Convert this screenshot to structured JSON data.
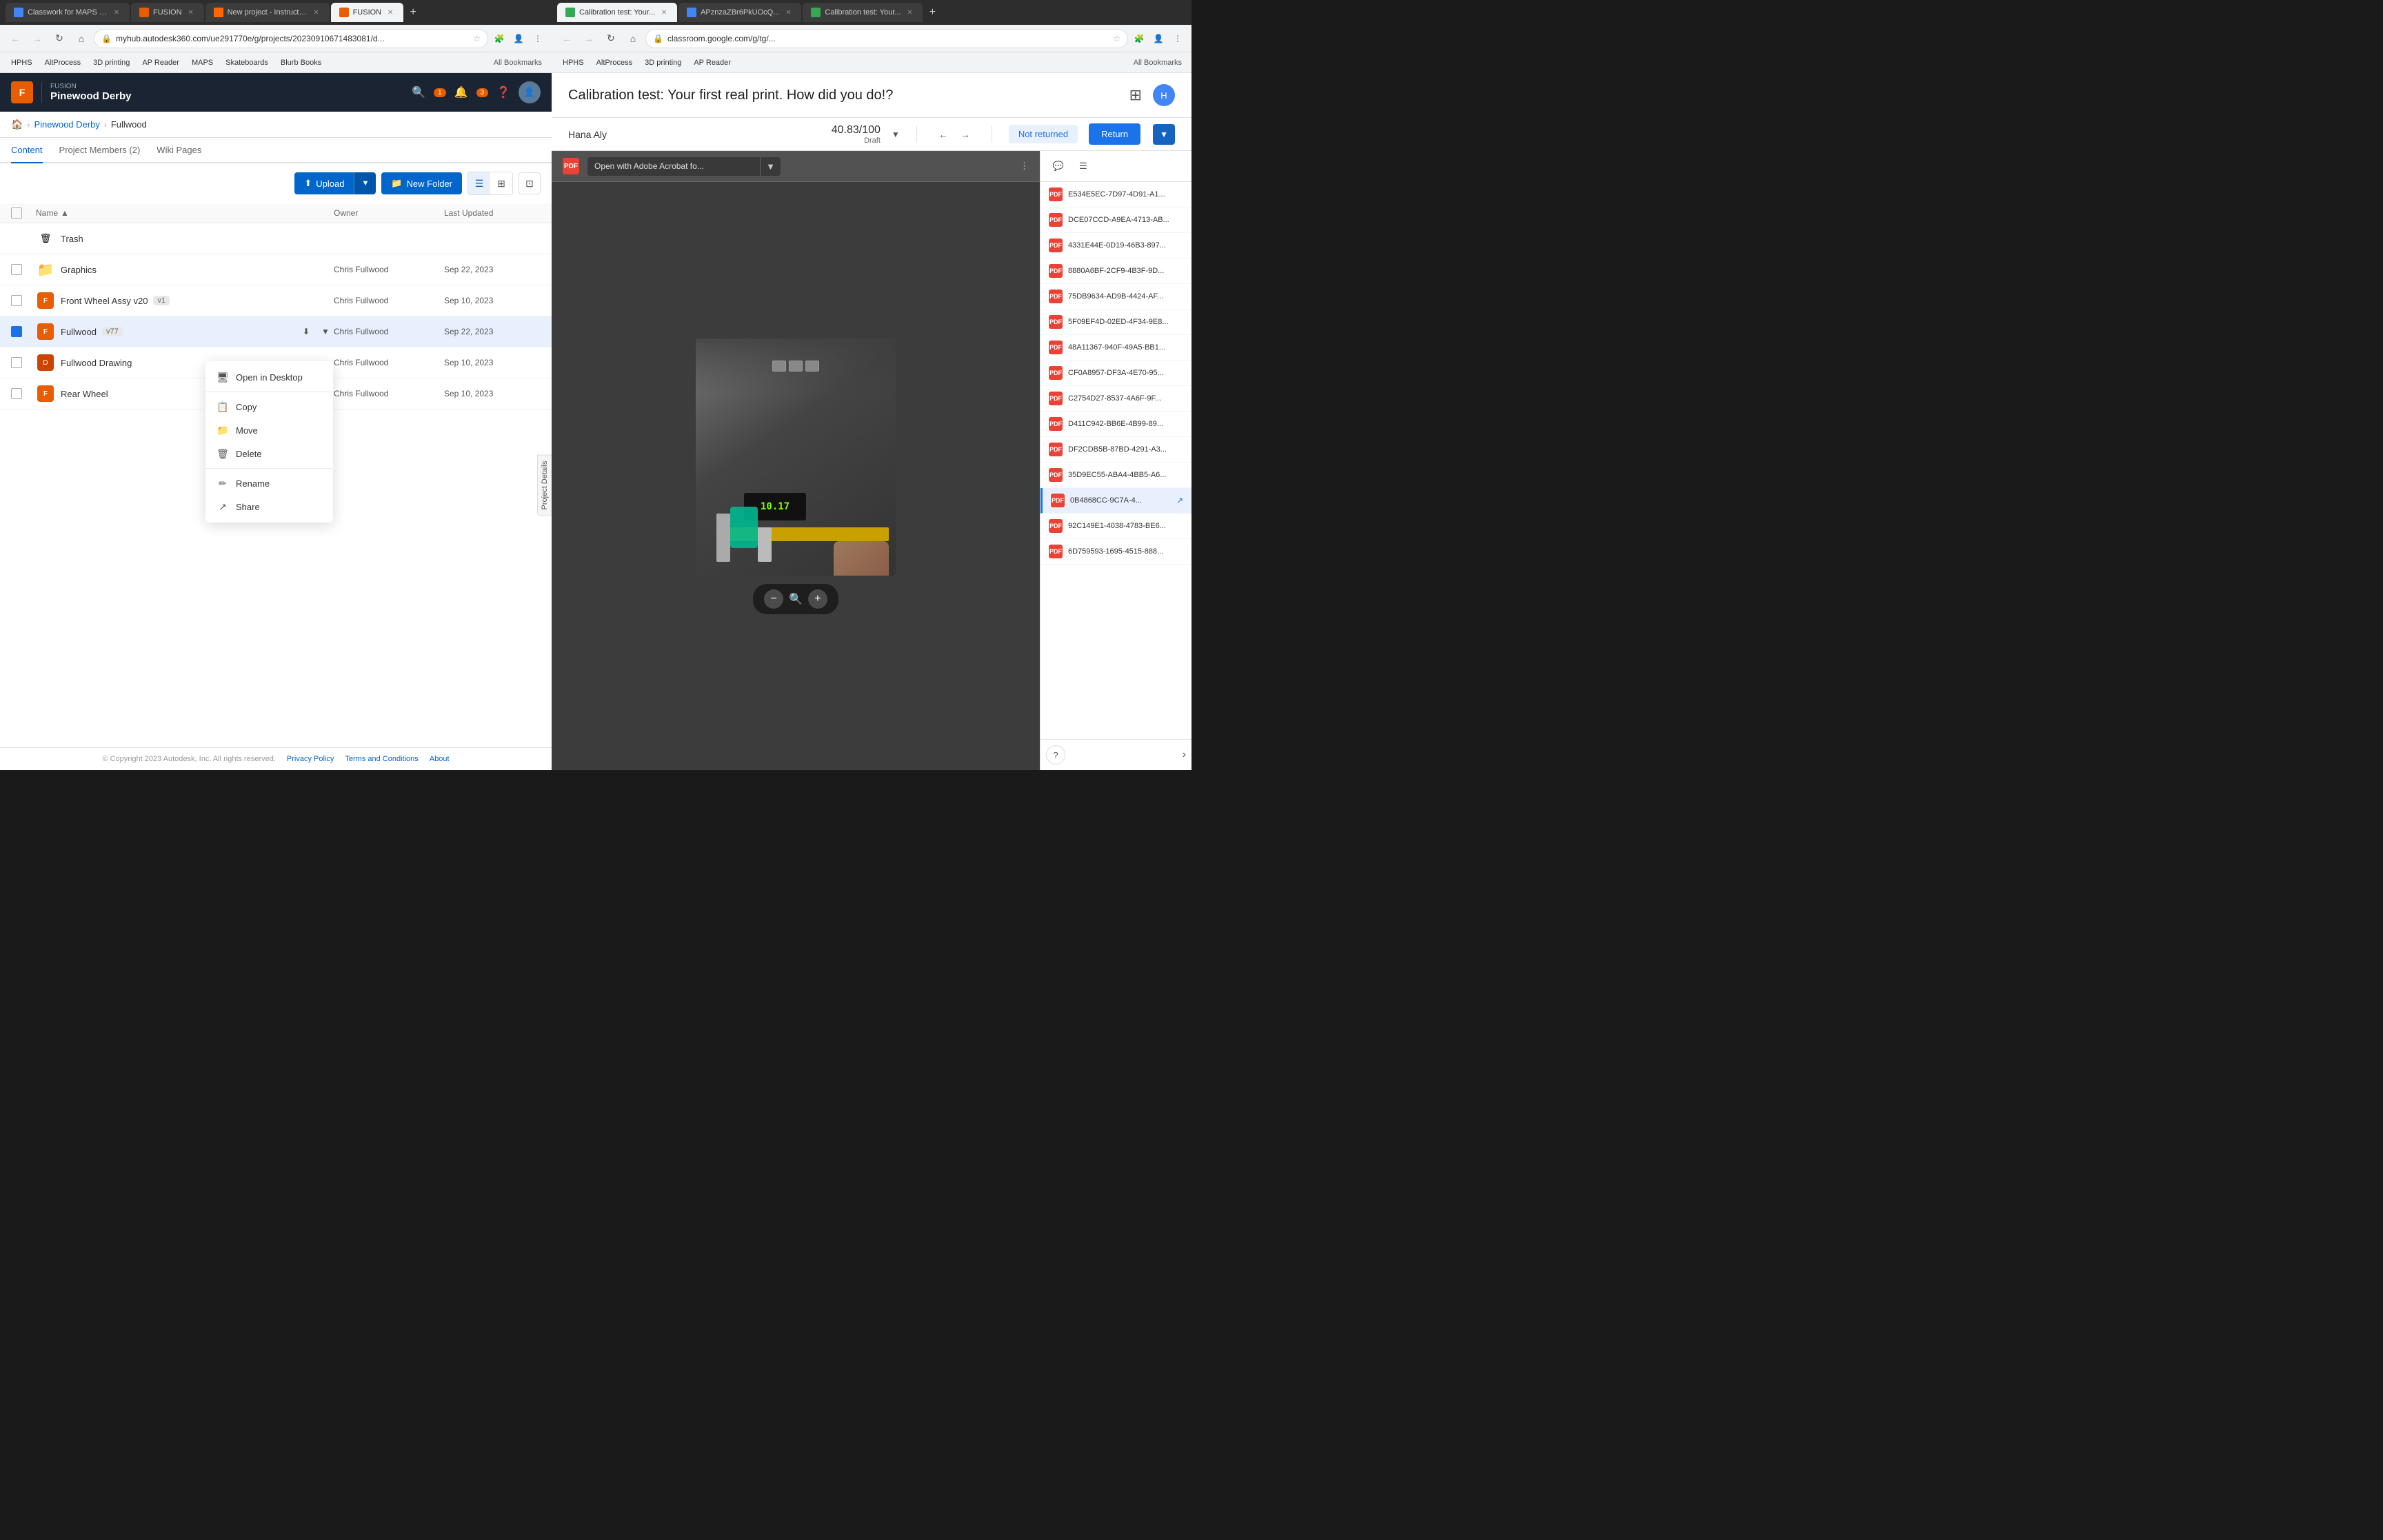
{
  "left": {
    "tabs": [
      {
        "id": "classwork",
        "label": "Classwork for MAPS Engi...",
        "favicon_color": "#4285f4",
        "active": false
      },
      {
        "id": "fusion1",
        "label": "FUSION",
        "favicon_color": "#e85d00",
        "active": false
      },
      {
        "id": "instructables",
        "label": "New project - Instructables",
        "favicon_color": "#f60",
        "active": false
      },
      {
        "id": "fusion2",
        "label": "FUSION",
        "favicon_color": "#e85d00",
        "active": true
      }
    ],
    "address": "myhub.autodesk360.com/ue291770e/g/projects/20230910671483081/d...",
    "bookmarks": [
      "HPHS",
      "AltProcess",
      "3D printing",
      "AP Reader",
      "MAPS",
      "Skateboards",
      "Blurb Books"
    ],
    "bookmarks_more": "All Bookmarks",
    "app": {
      "brand": "FUSION",
      "name": "Pinewood Derby",
      "notifications": "3",
      "alerts": "1"
    },
    "breadcrumb": {
      "home": "🏠",
      "project": "Pinewood Derby",
      "current": "Fullwood"
    },
    "tabs_nav": {
      "content": "Content",
      "members": "Project Members (2)",
      "wiki": "Wiki Pages"
    },
    "toolbar": {
      "upload": "Upload",
      "new_folder": "New Folder"
    },
    "columns": {
      "name": "Name",
      "sort": "▲",
      "owner": "Owner",
      "updated": "Last Updated"
    },
    "files": [
      {
        "type": "trash",
        "name": "Trash",
        "owner": "",
        "date": ""
      },
      {
        "type": "folder",
        "name": "Graphics",
        "owner": "Chris Fullwood",
        "date": "Sep 22, 2023"
      },
      {
        "type": "3d",
        "name": "Front Wheel Assy v20",
        "version": "v1",
        "owner": "Chris Fullwood",
        "date": "Sep 10, 2023"
      },
      {
        "type": "3d",
        "name": "Fullwood",
        "version": "v77",
        "owner": "Chris Fullwood",
        "date": "Sep 22, 2023",
        "selected": true
      },
      {
        "type": "drawing",
        "name": "Fullwood Drawing",
        "owner": "Chris Fullwood",
        "date": "Sep 10, 2023"
      },
      {
        "type": "3d",
        "name": "Rear Wheel",
        "owner": "Chris Fullwood",
        "date": "Sep 10, 2023"
      }
    ],
    "context_menu": {
      "items": [
        {
          "id": "open-desktop",
          "icon": "🖥",
          "label": "Open in Desktop"
        },
        {
          "id": "copy",
          "icon": "📋",
          "label": "Copy"
        },
        {
          "id": "move",
          "icon": "📁",
          "label": "Move"
        },
        {
          "id": "delete",
          "icon": "🗑",
          "label": "Delete"
        },
        {
          "id": "rename",
          "icon": "✏",
          "label": "Rename"
        },
        {
          "id": "share",
          "icon": "↗",
          "label": "Share"
        }
      ]
    },
    "project_details": "Project Details",
    "footer": {
      "copyright": "© Copyright 2023 Autodesk, Inc. All rights reserved.",
      "links": [
        "Privacy Policy",
        "Terms and Conditions",
        "About"
      ]
    }
  },
  "right": {
    "tabs": [
      {
        "id": "cal1",
        "label": "Calibration test: Your...",
        "active": true
      },
      {
        "id": "ap",
        "label": "APznzaZBr6PkUOcQ...",
        "active": false
      },
      {
        "id": "cal2",
        "label": "Calibration test: Your...",
        "active": false
      }
    ],
    "address": "classroom.google.com/g/tg/...",
    "bookmarks": [
      "HPHS",
      "AltProcess",
      "3D printing",
      "AP Reader"
    ],
    "bookmarks_more": "All Bookmarks",
    "classroom": {
      "title": "Calibration test: Your first real print. How did you do!?",
      "student": {
        "name": "Hana Aly",
        "score": "40.83/100",
        "score_label": "Draft",
        "status": "Not returned"
      },
      "buttons": {
        "return": "Return"
      },
      "pdf_open": "Open with Adobe Acrobat fo...",
      "submissions": [
        {
          "id": "sub1",
          "name": "E534E5EC-7D97-4D91-A1..."
        },
        {
          "id": "sub2",
          "name": "DCE07CCD-A9EA-4713-AB..."
        },
        {
          "id": "sub3",
          "name": "4331E44E-0D19-46B3-897..."
        },
        {
          "id": "sub4",
          "name": "8880A6BF-2CF9-4B3F-9D..."
        },
        {
          "id": "sub5",
          "name": "75DB9634-AD9B-4424-AF..."
        },
        {
          "id": "sub6",
          "name": "5F09EF4D-02ED-4F34-9E8..."
        },
        {
          "id": "sub7",
          "name": "48A11367-940F-49A5-BB1..."
        },
        {
          "id": "sub8",
          "name": "CF0A8957-DF3A-4E70-95..."
        },
        {
          "id": "sub9",
          "name": "C2754D27-8537-4A6F-9F..."
        },
        {
          "id": "sub10",
          "name": "D411C942-BB6E-4B99-89..."
        },
        {
          "id": "sub11",
          "name": "DF2CDB5B-87BD-4291-A3..."
        },
        {
          "id": "sub12",
          "name": "35D9EC55-ABA4-4BB5-A6..."
        },
        {
          "id": "sub13",
          "name": "0B4868CC-9C7A-4...",
          "active": true
        },
        {
          "id": "sub14",
          "name": "92C149E1-4038-4783-BE6..."
        },
        {
          "id": "sub15",
          "name": "6D759593-1695-4515-888..."
        }
      ]
    }
  }
}
